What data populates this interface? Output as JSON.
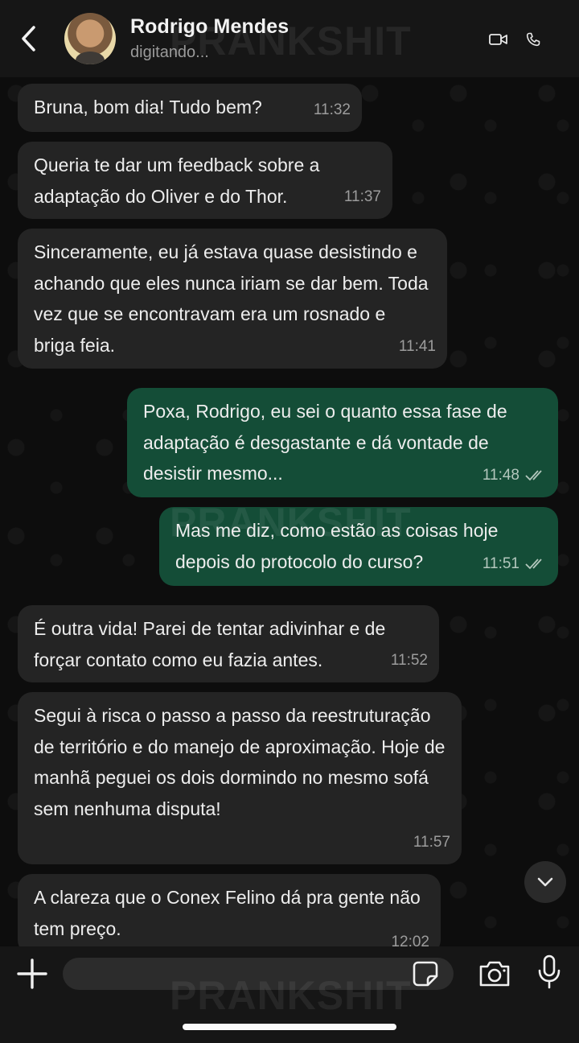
{
  "header": {
    "name": "Rodrigo Mendes",
    "status": "digitando..."
  },
  "messages": [
    {
      "direction": "in",
      "text": "Bruna, bom dia! Tudo bem?",
      "time": "11:32"
    },
    {
      "direction": "in",
      "text": "Queria te dar um feedback sobre a adaptação do Oliver e do Thor.",
      "time": "11:37"
    },
    {
      "direction": "in",
      "text": "Sinceramente, eu já estava quase desistindo e achando que eles nunca iriam se dar bem. Toda vez que se encontravam era um rosnado e briga feia.",
      "time": "11:41"
    },
    {
      "direction": "out",
      "text": "Poxa, Rodrigo, eu sei o quanto essa fase de adaptação é desgastante e dá vontade de desistir mesmo...",
      "time": "11:48",
      "read": true
    },
    {
      "direction": "out",
      "text": "Mas me diz, como estão as coisas hoje depois do protocolo do curso?",
      "time": "11:51",
      "read": true
    },
    {
      "direction": "in",
      "text": "É outra vida! Parei de tentar adivinhar e de forçar contato como eu fazia antes.",
      "time": "11:52"
    },
    {
      "direction": "in",
      "text": "Segui à risca o passo a passo da reestruturação de território e do manejo de aproximação. Hoje de manhã peguei os dois dormindo no mesmo sofá sem nenhuma disputa!",
      "time": "11:57"
    },
    {
      "direction": "in",
      "text": "A clareza que o Conex Felino dá pra gente não tem preço.",
      "time": "12:02"
    }
  ],
  "composer": {
    "value": "",
    "placeholder": ""
  },
  "watermark": "PRANKSHIT",
  "colors": {
    "header_bg": "#161616",
    "incoming_bubble": "#242424",
    "outgoing_bubble": "#144d37",
    "chat_bg": "#0d0d0d",
    "read_ticks": "#b3c7bd"
  },
  "icons": [
    "back-arrow-icon",
    "video-call-icon",
    "phone-icon",
    "chevron-down-icon",
    "plus-icon",
    "sticker-icon",
    "camera-icon",
    "microphone-icon",
    "double-check-icon"
  ]
}
